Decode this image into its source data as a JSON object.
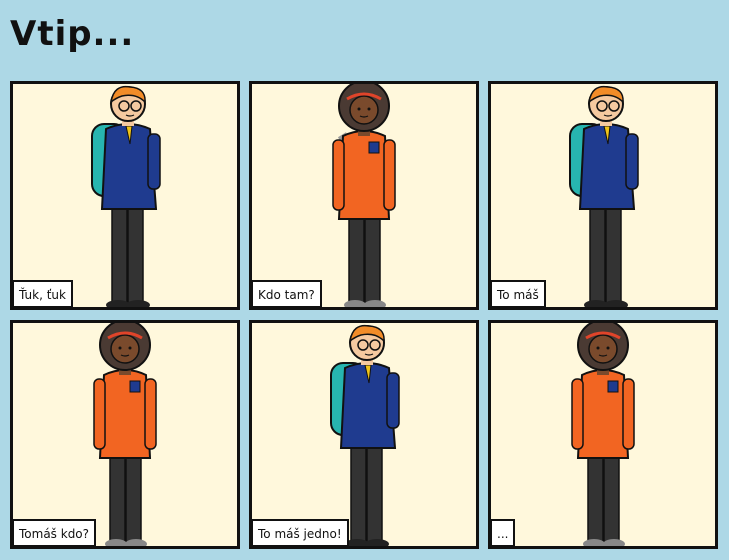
{
  "title": "Vtip...",
  "panels": [
    {
      "character": "boy",
      "caption": "Ťuk, ťuk"
    },
    {
      "character": "girl",
      "caption": "Kdo tam?"
    },
    {
      "character": "boy",
      "caption": "To máš"
    },
    {
      "character": "girl",
      "caption": "Tomáš kdo?"
    },
    {
      "character": "boy",
      "caption": "To máš jedno!"
    },
    {
      "character": "girl",
      "caption": "..."
    }
  ],
  "colors": {
    "background": "#add8e6",
    "panel": "#fff8dc",
    "boy_hair": "#f28c28",
    "boy_sweater": "#1f3b8f",
    "backpack": "#27b5b0",
    "girl_sweater": "#f26522",
    "girl_hair": "#4a3a33",
    "trousers": "#333333"
  }
}
